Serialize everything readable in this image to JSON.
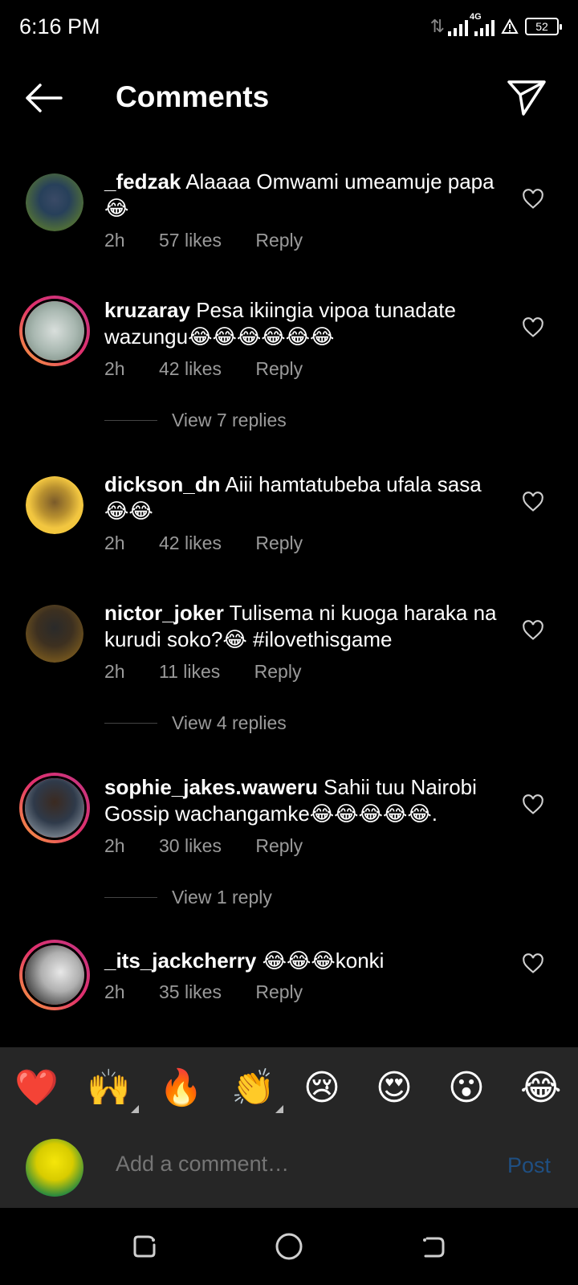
{
  "status": {
    "time": "6:16 PM",
    "network": "4G",
    "battery": "52"
  },
  "header": {
    "title": "Comments"
  },
  "comments": [
    {
      "username": "_fedzak",
      "text": "Alaaaa Omwami umeamuje papa😂",
      "time": "2h",
      "likes": "57 likes",
      "reply": "Reply"
    },
    {
      "username": "kruzaray",
      "text": "Pesa ikiingia vipoa tunadate wazungu😂😂😂😂😂😂",
      "time": "2h",
      "likes": "42 likes",
      "reply": "Reply",
      "view_replies": "View 7 replies"
    },
    {
      "username": "dickson_dn",
      "text": "Aiii hamtatubeba ufala sasa 😂😂",
      "time": "2h",
      "likes": "42 likes",
      "reply": "Reply"
    },
    {
      "username": "nictor_joker",
      "text": "Tulisema ni kuoga haraka na kurudi soko?😂 #ilovethisgame",
      "time": "2h",
      "likes": "11 likes",
      "reply": "Reply",
      "view_replies": "View 4 replies"
    },
    {
      "username": "sophie_jakes.waweru",
      "text": "Sahii tuu Nairobi Gossip wachangamke😂😂😂😂😂.",
      "time": "2h",
      "likes": "30 likes",
      "reply": "Reply",
      "view_replies": "View 1 reply"
    },
    {
      "username": "_its_jackcherry",
      "text": "😂😂😂konki",
      "time": "2h",
      "likes": "35 likes",
      "reply": "Reply"
    }
  ],
  "emoji_bar": [
    "❤️",
    "🙌",
    "🔥",
    "👏",
    "😢",
    "😍",
    "😮",
    "😂"
  ],
  "composer": {
    "placeholder": "Add a comment…",
    "post_label": "Post"
  },
  "colors": {
    "background": "#000000",
    "panel": "#262626",
    "muted_text": "#9a9a9a",
    "post_disabled": "#1f4f82"
  }
}
